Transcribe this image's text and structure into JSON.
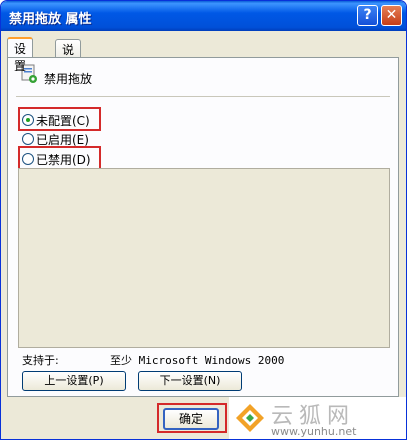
{
  "window": {
    "title": "禁用拖放 属性"
  },
  "titlebar": {
    "help": "?",
    "close": "✕"
  },
  "tabs": [
    {
      "label": "设置"
    },
    {
      "label": "说明"
    }
  ],
  "policy": {
    "name": "禁用拖放"
  },
  "radios": [
    {
      "label": "未配置(C)",
      "checked": true
    },
    {
      "label": "已启用(E)",
      "checked": false
    },
    {
      "label": "已禁用(D)",
      "checked": false
    }
  ],
  "supported": {
    "label": "支持于:",
    "value": "至少 Microsoft Windows 2000"
  },
  "buttons": {
    "prev": "上一设置(P)",
    "next": "下一设置(N)",
    "ok": "确定"
  },
  "watermark": {
    "text": "云狐网",
    "url": "www.yunhu.net"
  }
}
